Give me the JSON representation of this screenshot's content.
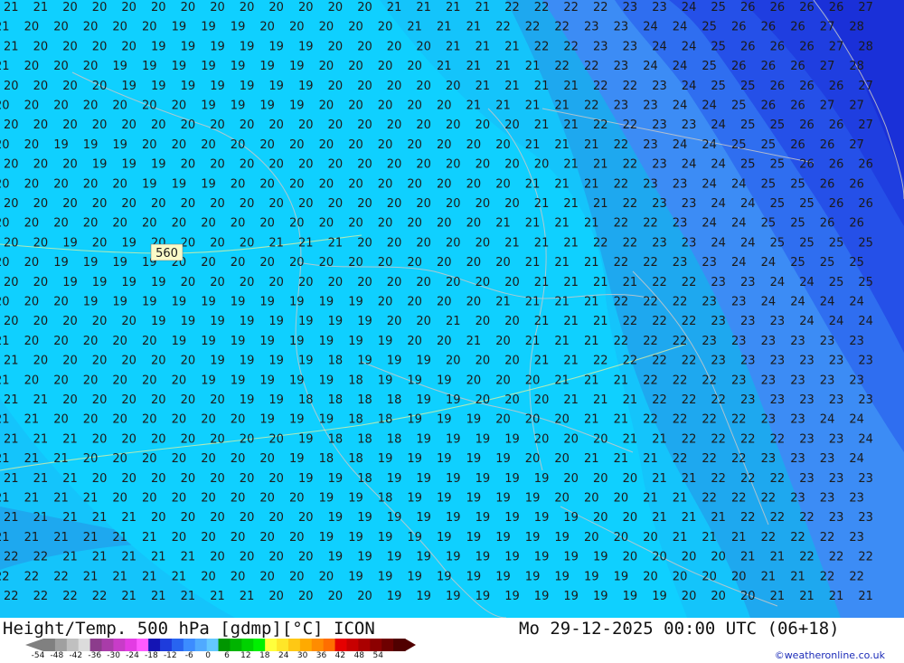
{
  "header": {
    "title_left": "Height/Temp. 500 hPa [gdmp][°C] ICON",
    "title_right": "Mo 29-12-2025 00:00 UTC (06+18)"
  },
  "credit": "©weatheronline.co.uk",
  "contour_value": "560",
  "legend": {
    "ticks": [
      "-54",
      "-48",
      "-42",
      "-36",
      "-30",
      "-24",
      "-18",
      "-12",
      "-6",
      "0",
      "6",
      "12",
      "18",
      "24",
      "30",
      "36",
      "42",
      "48",
      "54"
    ],
    "colors": [
      "#808080",
      "#a0a0a0",
      "#c0c0c0",
      "#dcdcdc",
      "#8c3c8c",
      "#a93ca9",
      "#c83cc8",
      "#e33ce3",
      "#ff5aff",
      "#1414b4",
      "#1e3cdc",
      "#2864f0",
      "#3c8cff",
      "#50aaff",
      "#64c8ff",
      "#009600",
      "#00b400",
      "#00d200",
      "#00f000",
      "#ffff3c",
      "#ffe628",
      "#ffc814",
      "#ffaa00",
      "#ff8c00",
      "#ff6e00",
      "#e60000",
      "#c80000",
      "#aa0000",
      "#8c0000",
      "#6e0000",
      "#500000"
    ]
  },
  "map": {
    "zone_colors": [
      "#1ea8ef",
      "#14c4fb",
      "#0fd0ff",
      "#3c8cf5",
      "#2f6ef0",
      "#2550e8",
      "#1f3ee0",
      "#1a30d8"
    ],
    "temp_rows": [
      "21 21 20 20 20 20 20 20 20 20 20 20 20 21 21 21 21 22 22 22 22 23 23 24 25 26 26 26 26 27",
      "21 20 20 20 20 20 19 19 19 20 20 20 20 20 21 21 21 22 22 22 23 23 24 24 25 26 26 26 27 28",
      "21 20 20 20 20 19 19 19 19 19 19 20 20 20 20 21 21 21 22 22 23 23 24 24 25 26 26 26 27 28",
      "21 20 20 20 19 19 19 19 19 19 19 20 20 20 20 21 21 21 21 22 22 23 24 24 25 26 26 26 27 28",
      "20 20 20 20 19 19 19 19 19 19 19 20 20 20 20 20 21 21 21 21 22 22 23 24 25 25 26 26 26 27",
      "20 20 20 20 20 20 20 19 19 19 19 20 20 20 20 20 21 21 21 21 22 23 23 24 24 25 26 26 27 27",
      "20 20 20 20 20 20 20 20 20 20 20 20 20 20 20 20 20 20 21 21 22 22 23 23 24 25 25 26 26 27",
      "20 20 19 19 19 20 20 20 20 20 20 20 20 20 20 20 20 20 21 21 21 22 23 24 24 25 25 26 26 27",
      "20 20 20 19 19 19 20 20 20 20 20 20 20 20 20 20 20 20 20 21 21 22 23 24 24 25 25 26 26 26",
      "20 20 20 20 20 19 19 19 20 20 20 20 20 20 20 20 20 20 21 21 21 22 23 23 24 24 25 25 26 26",
      "20 20 20 20 20 20 20 20 20 20 20 20 20 20 20 20 20 20 21 21 21 22 23 23 24 24 25 25 26 26",
      "20 20 20 20 20 20 20 20 20 20 20 20 20 20 20 20 20 21 21 21 21 22 22 23 24 24 25 25 26 26",
      "20 20 19 20 19 20 20 20 20 21 21 21 20 20 20 20 20 21 21 21 22 22 23 23 24 24 25 25 25 25",
      "20 20 19 19 19 19 20 20 20 20 20 20 20 20 20 20 20 20 21 21 21 22 22 23 23 24 24 25 25 25",
      "20 20 19 19 19 19 20 20 20 20 20 20 20 20 20 20 20 20 21 21 21 21 22 22 23 23 24 24 25 25",
      "20 20 20 19 19 19 19 19 19 19 19 19 19 20 20 20 20 21 21 21 21 22 22 22 23 23 24 24 24 24",
      "20 20 20 20 20 19 19 19 19 19 19 19 19 20 20 21 20 20 21 21 21 22 22 22 23 23 23 24 24 24",
      "21 20 20 20 20 20 19 19 19 19 19 19 19 19 20 20 21 20 21 21 21 22 22 22 23 23 23 23 23 23",
      "21 20 20 20 20 20 20 19 19 19 19 18 19 19 19 20 20 20 21 21 22 22 22 22 23 23 23 23 23 23",
      "21 20 20 20 20 20 20 19 19 19 19 19 18 19 19 19 20 20 20 21 21 21 22 22 22 23 23 23 23 23",
      "21 21 20 20 20 20 20 20 19 19 18 18 18 18 19 19 20 20 20 21 21 21 22 22 22 23 23 23 23 23",
      "21 21 20 20 20 20 20 20 20 19 19 19 18 18 19 19 19 20 20 20 21 21 22 22 22 22 23 23 24 24",
      "21 21 21 20 20 20 20 20 20 20 19 18 18 18 19 19 19 19 20 20 20 21 21 22 22 22 22 23 23 24",
      "21 21 21 20 20 20 20 20 20 20 19 18 18 19 19 19 19 19 20 20 21 21 21 22 22 22 23 23 23 24",
      "21 21 21 20 20 20 20 20 20 20 19 19 18 19 19 19 19 19 19 20 20 20 21 21 22 22 22 23 23 23",
      "21 21 21 21 20 20 20 20 20 20 20 19 19 18 19 19 19 19 19 20 20 20 21 21 22 22 22 23 23 23",
      "21 21 21 21 21 20 20 20 20 20 20 19 19 19 19 19 19 19 19 19 20 20 21 21 21 22 22 22 23 23",
      "21 21 21 21 21 21 20 20 20 20 20 19 19 19 19 19 19 19 19 19 20 20 20 21 21 21 22 22 22 23",
      "22 22 21 21 21 21 21 20 20 20 20 19 19 19 19 19 19 19 19 19 19 20 20 20 20 21 21 22 22 22",
      "22 22 22 21 21 21 21 20 20 20 20 20 19 19 19 19 19 19 19 19 19 19 20 20 20 20 21 21 22 22",
      "22 22 22 22 21 21 21 21 21 20 20 20 20 19 19 19 19 19 19 19 19 19 19 20 20 20 21 21 21 21"
    ]
  }
}
